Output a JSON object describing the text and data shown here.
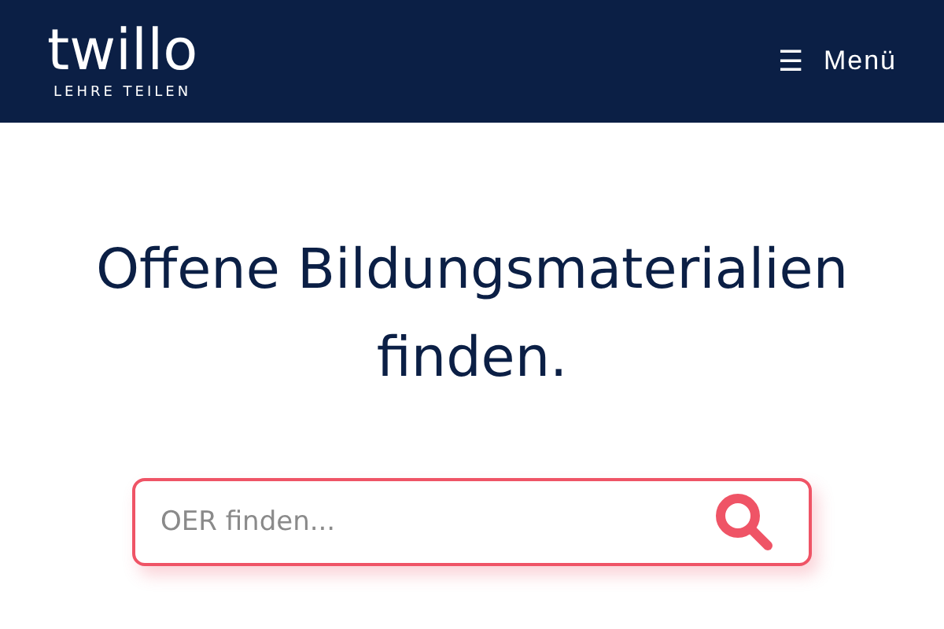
{
  "header": {
    "logo": "twillo",
    "tagline": "LEHRE TEILEN",
    "menu_icon": "☰",
    "menu_label": "Menü"
  },
  "headline": "Offene Bildungsmaterialien finden.",
  "search": {
    "placeholder": "OER finden..."
  }
}
